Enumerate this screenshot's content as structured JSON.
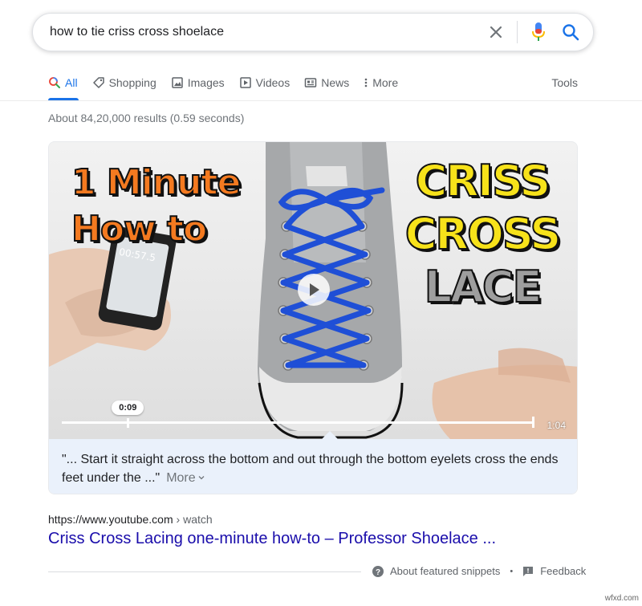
{
  "search": {
    "query": "how to tie criss cross shoelace",
    "icons": [
      "close-icon",
      "mic-icon",
      "search-icon"
    ],
    "colors": {
      "mic_blue": "#4285f4",
      "mic_red": "#ea4335",
      "search_blue": "#1a73e8"
    }
  },
  "tabs": {
    "items": [
      {
        "label": "All",
        "icon": "search-icon",
        "active": true
      },
      {
        "label": "Shopping",
        "icon": "tag-icon"
      },
      {
        "label": "Images",
        "icon": "image-icon"
      },
      {
        "label": "Videos",
        "icon": "play-icon"
      },
      {
        "label": "News",
        "icon": "news-icon"
      },
      {
        "label": "More",
        "icon": "more-vertical-icon"
      }
    ],
    "tools": "Tools"
  },
  "result_stats": "About 84,20,000 results (0.59 seconds)",
  "video": {
    "overlay_left": [
      "1 Minute",
      "How to"
    ],
    "overlay_right": [
      "CRISS",
      "CROSS",
      "LACE"
    ],
    "phone_timer": "00:57.5",
    "current_time": "0:09",
    "duration": "1:04",
    "progress": 0.14
  },
  "snippet": {
    "text": "\"... Start it straight across the bottom and out through the bottom eyelets cross the ends feet under the ...\"",
    "more": "More"
  },
  "result": {
    "url": "https://www.youtube.com",
    "breadcrumb": " › watch",
    "title": "Criss Cross Lacing one-minute how-to – Professor Shoelace ..."
  },
  "footer": {
    "about": "About featured snippets",
    "separator": "•",
    "feedback": "Feedback"
  },
  "watermark": "wfxd.com"
}
